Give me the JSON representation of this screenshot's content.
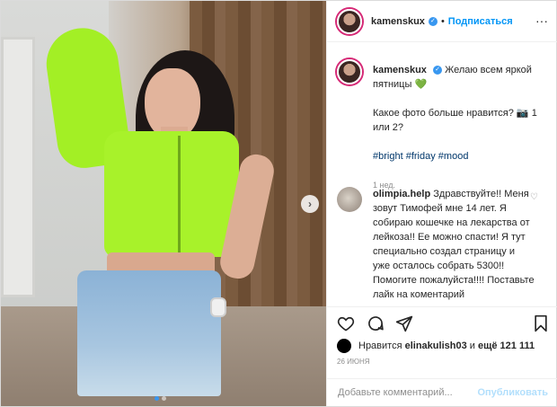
{
  "post": {
    "username": "kamenskux",
    "follow_label": "Подписаться",
    "separator": "•",
    "more_label": "···"
  },
  "caption": {
    "username": "kamenskux",
    "text_1": "Желаю всем яркой пятницы",
    "emoji_heart": "💚",
    "text_2": "Какое фото больше нравится? 📷 1 или 2?",
    "hashtags": [
      "#bright",
      "#friday",
      "#mood"
    ],
    "age": "1 нед."
  },
  "comment": {
    "username": "olimpia.help",
    "text": "Здравствуйте!! Меня зовут Тимофей мне 14 лет. Я собираю кошечке на лекарства от лейкоза!! Ее можно спасти! Я тут специально создал страницу и уже осталось собрать 5300!! Помогите пожалуйста!!!! Поставьте лайк на коментарий"
  },
  "likes": {
    "prefix": "Нравится",
    "user": "elinakulish03",
    "and_label": "и",
    "count_label": "ещё 121 111"
  },
  "date": "26 июня",
  "add_comment": {
    "placeholder": "Добавьте комментарий...",
    "publish_label": "Опубликовать"
  },
  "carousel": {
    "current": 1,
    "total": 2
  }
}
